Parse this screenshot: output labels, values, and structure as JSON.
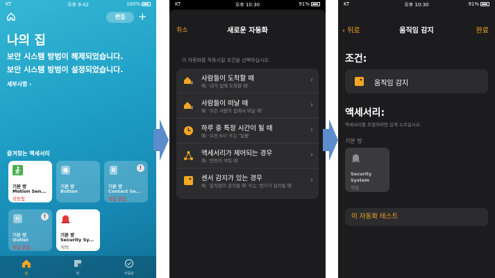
{
  "colors": {
    "accent": "#f5a623",
    "alert_red": "#e53935",
    "home_teal": "#1fa0c7",
    "arrow_blue": "#5b8ccc"
  },
  "screen1": {
    "status": {
      "carrier": "KT",
      "time": "오후 9:42",
      "battery": "100%"
    },
    "edit_label": "편집",
    "add_label": "+",
    "home_title": "나의 집",
    "alerts": [
      "보안 시스템 방범이 해제되었습니다.",
      "보안 시스템 방범이 설정되었습니다."
    ],
    "details_link": "세부사항",
    "favorites_title": "즐겨찾는 액세서리",
    "tiles": [
      {
        "room": "기본 방",
        "name": "Motion Sen...",
        "status": "작동됨",
        "icon": "walking-person-icon",
        "on": true,
        "alert": false
      },
      {
        "room": "기본 방",
        "name": "Button",
        "status": "",
        "icon": "button-icon",
        "on": false,
        "alert": false
      },
      {
        "room": "기본 방",
        "name": "Contact Se...",
        "status": "응답 없음",
        "icon": "contact-sensor-icon",
        "on": false,
        "alert": true
      },
      {
        "room": "기본 방",
        "name": "Outlet",
        "status": "응답 없음",
        "icon": "outlet-icon",
        "on": false,
        "alert": true
      },
      {
        "room": "기본 방",
        "name": "Security Sy...",
        "status": "재택",
        "icon": "siren-icon",
        "on": true,
        "alert": false
      }
    ],
    "tabs": [
      {
        "label": "홈",
        "icon": "house-icon",
        "active": true
      },
      {
        "label": "방",
        "icon": "room-icon",
        "active": false
      },
      {
        "label": "자동화",
        "icon": "clock-check-icon",
        "active": false
      }
    ]
  },
  "screen2": {
    "status": {
      "carrier": "KT",
      "time": "오후 10:30",
      "battery": "91%"
    },
    "cancel_label": "취소",
    "title": "새로운 자동화",
    "prompt": "이 자동화를 작동시킬 조건을 선택하십시오.",
    "options": [
      {
        "title": "사람들이 도착할 때",
        "subtitle": "예: '내가 집에 도착할 때'",
        "icon": "house-arrive-icon"
      },
      {
        "title": "사람들이 떠날 때",
        "subtitle": "예: '모든 사람이 집에서 떠날 때'",
        "icon": "house-leave-icon"
      },
      {
        "title": "하루 중 특정 시간이 될 때",
        "subtitle": "예: '오전 8시' 또는 '일몰'",
        "icon": "clock-icon"
      },
      {
        "title": "액세서리가 제어되는 경우",
        "subtitle": "예: '전등이 켜질 때'",
        "icon": "accessory-nodes-icon"
      },
      {
        "title": "센서 감지가 있는 경우",
        "subtitle": "예: '움직임이 감지될 때' 또는 '연기가 감지될 때'",
        "icon": "sensor-icon"
      }
    ]
  },
  "screen3": {
    "status": {
      "carrier": "KT",
      "time": "오후 10:30",
      "battery": "91%"
    },
    "back_label": "뒤로",
    "title": "움직임 감지",
    "done_label": "완료",
    "conditions_header": "조건:",
    "condition_label": "움직임 감지",
    "accessories_header": "액세서리:",
    "accessories_hint": "액세서리를 조절하려면 길게 누르십시오.",
    "room_label": "기본 방",
    "accessory": {
      "name_line1": "Security",
      "name_line2": "System",
      "state": "꺼짐"
    },
    "test_label": "이 자동화 테스트"
  }
}
